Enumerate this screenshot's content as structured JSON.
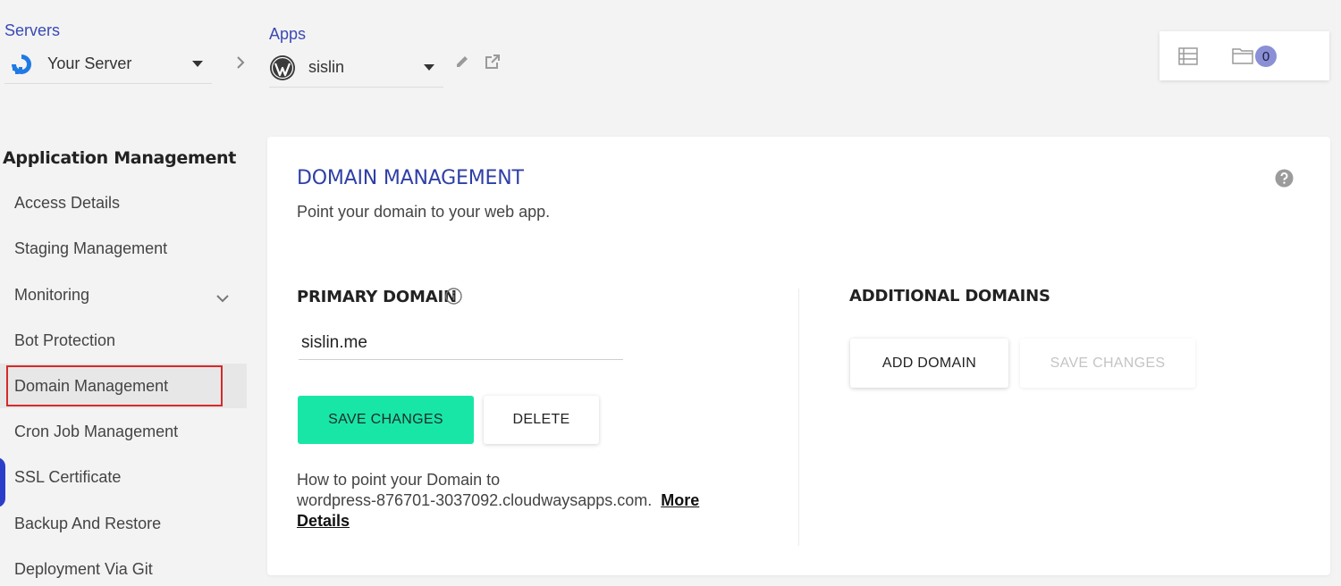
{
  "header": {
    "servers_label": "Servers",
    "server_name": "Your Server",
    "apps_label": "Apps",
    "app_name": "sislin",
    "notification_count": "0"
  },
  "sidebar": {
    "title": "Application Management",
    "items": [
      {
        "label": "Access Details"
      },
      {
        "label": "Staging Management"
      },
      {
        "label": "Monitoring"
      },
      {
        "label": "Bot Protection"
      },
      {
        "label": "Domain Management"
      },
      {
        "label": "Cron Job Management"
      },
      {
        "label": "SSL Certificate"
      },
      {
        "label": "Backup And Restore"
      },
      {
        "label": "Deployment Via Git"
      }
    ]
  },
  "main": {
    "title": "DOMAIN MANAGEMENT",
    "subtitle": "Point your domain to your web app.",
    "primary": {
      "heading": "PRIMARY DOMAIN",
      "value": "sislin.me",
      "save_label": "SAVE CHANGES",
      "delete_label": "DELETE"
    },
    "additional": {
      "heading": "ADDITIONAL DOMAINS",
      "add_label": "ADD DOMAIN",
      "save_label": "SAVE CHANGES"
    },
    "howto": {
      "line1": "How to point your Domain to",
      "line2": "wordpress-876701-3037092.cloudwaysapps.com.",
      "link_label_1": "More",
      "link_label_2": "Details"
    }
  },
  "colors": {
    "accent_green": "#18e6a6",
    "brand_blue": "#2f3fa6",
    "highlight_red": "#d52a2a"
  }
}
